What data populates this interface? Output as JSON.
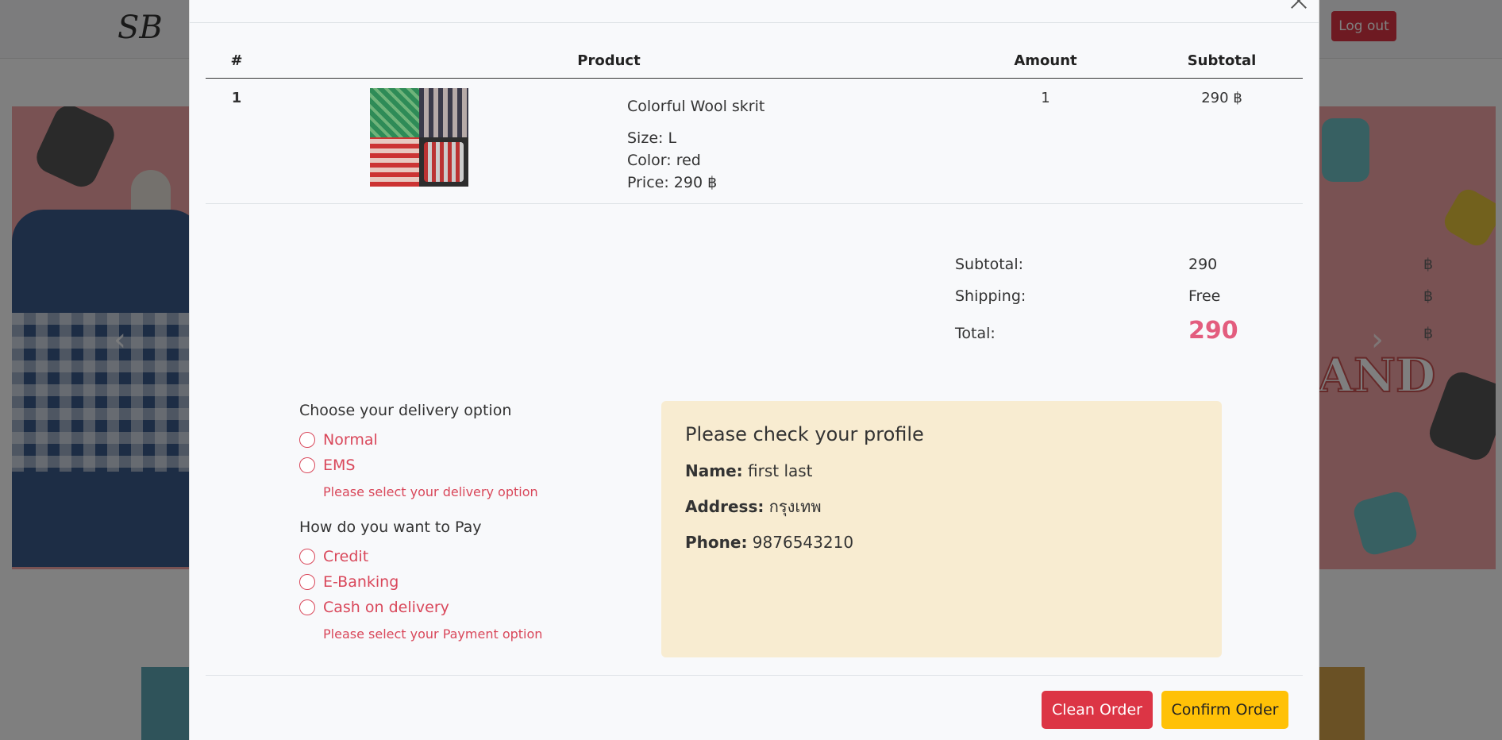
{
  "background": {
    "logo": "SB",
    "logout_label": "Log out",
    "prev_arrow": "‹",
    "next_arrow": "›",
    "banner_word": "AND"
  },
  "modal": {
    "close_icon": "close-icon",
    "table": {
      "headers": [
        "#",
        "Product",
        "Amount",
        "Subtotal"
      ],
      "rows": [
        {
          "num": "1",
          "name": "Colorful Wool skrit",
          "size": "Size: L",
          "color": "Color: red",
          "price": "Price: 290 ฿",
          "amount": "1",
          "subtotal": "290 ฿"
        }
      ]
    },
    "totals": {
      "subtotal_label": "Subtotal:",
      "subtotal_value": "290",
      "shipping_label": "Shipping:",
      "shipping_value": "Free",
      "total_label": "Total:",
      "total_value": "290",
      "currency": "฿"
    },
    "delivery": {
      "title": "Choose your delivery option",
      "options": [
        "Normal",
        "EMS"
      ],
      "error": "Please select your delivery option"
    },
    "payment": {
      "title": "How do you want to Pay",
      "options": [
        "Credit",
        "E-Banking",
        "Cash on delivery"
      ],
      "error": "Please select your Payment option"
    },
    "profile": {
      "title": "Please check your profile",
      "name_label": "Name:",
      "name_value": "first last",
      "address_label": "Address:",
      "address_value": "กรุงเทพ",
      "phone_label": "Phone:",
      "phone_value": "9876543210"
    },
    "buttons": {
      "clean": "Clean Order",
      "confirm": "Confirm Order"
    },
    "colors": {
      "danger": "#dc3545",
      "warning": "#ffc107",
      "total_accent": "#e35d7e",
      "profile_bg": "#f8ecd1"
    }
  }
}
